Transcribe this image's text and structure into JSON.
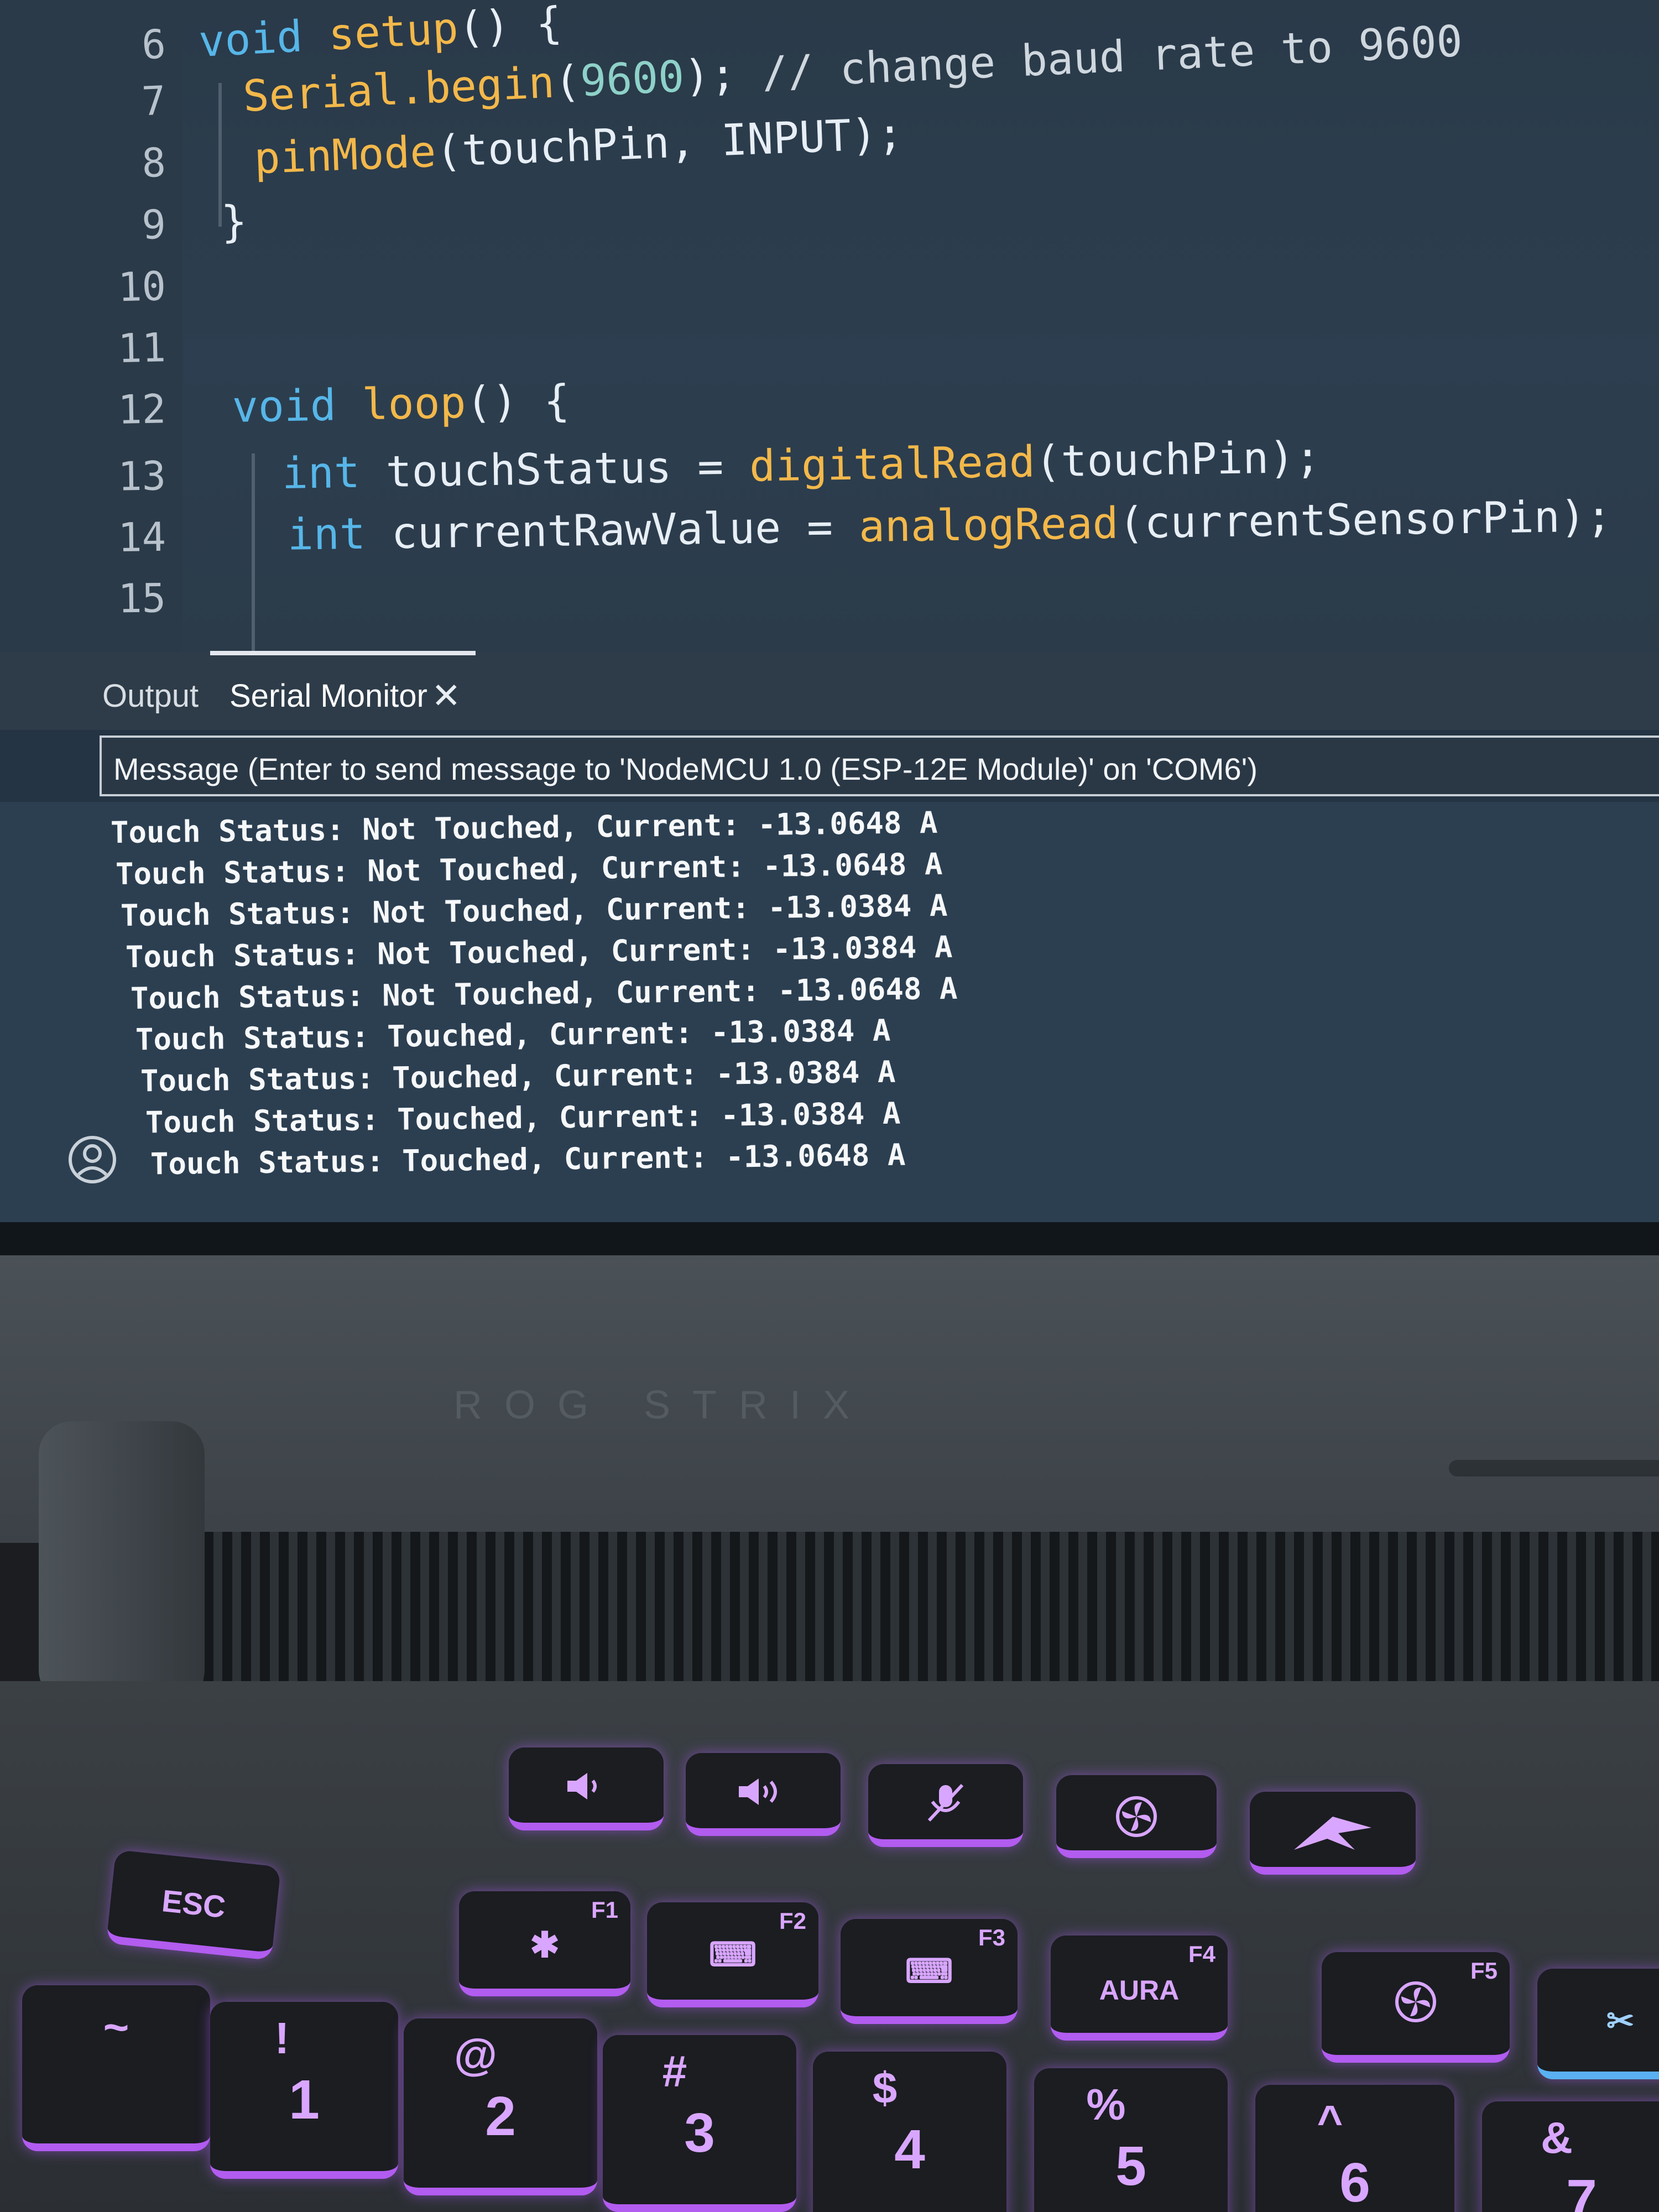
{
  "editor": {
    "lines": [
      {
        "num": "6",
        "tokens": [
          {
            "t": "kw",
            "v": "void "
          },
          {
            "t": "fn",
            "v": "setup"
          },
          {
            "t": "brace",
            "v": "() {"
          }
        ]
      },
      {
        "num": "7",
        "tokens": [
          {
            "t": "fn",
            "v": "Serial.begin"
          },
          {
            "t": "brace",
            "v": "("
          },
          {
            "t": "lit",
            "v": "9600"
          },
          {
            "t": "brace",
            "v": ");"
          },
          {
            "t": "cm",
            "v": " // change baud rate to 9600"
          }
        ]
      },
      {
        "num": "8",
        "tokens": [
          {
            "t": "fn",
            "v": "pinMode"
          },
          {
            "t": "brace",
            "v": "(touchPin, INPUT);"
          }
        ]
      },
      {
        "num": "9",
        "tokens": [
          {
            "t": "brace",
            "v": "}"
          }
        ]
      },
      {
        "num": "10",
        "tokens": []
      },
      {
        "num": "11",
        "tokens": []
      },
      {
        "num": "12",
        "tokens": [
          {
            "t": "kw",
            "v": "void "
          },
          {
            "t": "fn",
            "v": "loop"
          },
          {
            "t": "brace",
            "v": "() {"
          }
        ]
      },
      {
        "num": "13",
        "tokens": [
          {
            "t": "kw",
            "v": "int "
          },
          {
            "t": "brace",
            "v": "touchStatus = "
          },
          {
            "t": "fn",
            "v": "digitalRead"
          },
          {
            "t": "brace",
            "v": "(touchPin);"
          }
        ]
      },
      {
        "num": "14",
        "tokens": [
          {
            "t": "kw",
            "v": "int "
          },
          {
            "t": "brace",
            "v": "currentRawValue = "
          },
          {
            "t": "fn",
            "v": "analogRead"
          },
          {
            "t": "brace",
            "v": "(currentSensorPin);"
          }
        ]
      },
      {
        "num": "15",
        "tokens": []
      }
    ]
  },
  "panel": {
    "tabs": [
      {
        "label": "Output",
        "active": false
      },
      {
        "label": "Serial Monitor",
        "active": true
      }
    ],
    "close_symbol": "✕",
    "message_placeholder": "Message (Enter to send message to 'NodeMCU 1.0 (ESP-12E Module)' on 'COM6')"
  },
  "serial_monitor": {
    "lines": [
      "Touch Status: Not Touched, Current: -13.0648 A",
      "Touch Status: Not Touched, Current: -13.0648 A",
      "Touch Status: Not Touched, Current: -13.0384 A",
      "Touch Status: Not Touched, Current: -13.0384 A",
      "Touch Status: Not Touched, Current: -13.0648 A",
      "Touch Status: Touched, Current: -13.0384 A",
      "Touch Status: Touched, Current: -13.0384 A",
      "Touch Status: Touched, Current: -13.0384 A",
      "Touch Status: Touched, Current: -13.0648 A"
    ]
  },
  "laptop": {
    "logo": "ROG STRIX",
    "keys": {
      "esc": "ESC",
      "f1": "F1",
      "f2": "F2",
      "f3": "F3",
      "f4": "F4",
      "f4_main": "AURA",
      "f5": "F5",
      "k1_top": "!",
      "k1": "1",
      "k2_top": "@",
      "k2": "2",
      "k3_top": "#",
      "k3": "3",
      "k4_top": "$",
      "k4": "4",
      "k5_top": "%",
      "k5": "5",
      "k6_top": "^",
      "k6": "6",
      "k7_top": "&",
      "k7": "7"
    }
  },
  "colors": {
    "keyword": "#57b6e8",
    "function": "#f3b84a",
    "literal": "#8ed1c8",
    "key_backlight": "#b25cf0"
  }
}
